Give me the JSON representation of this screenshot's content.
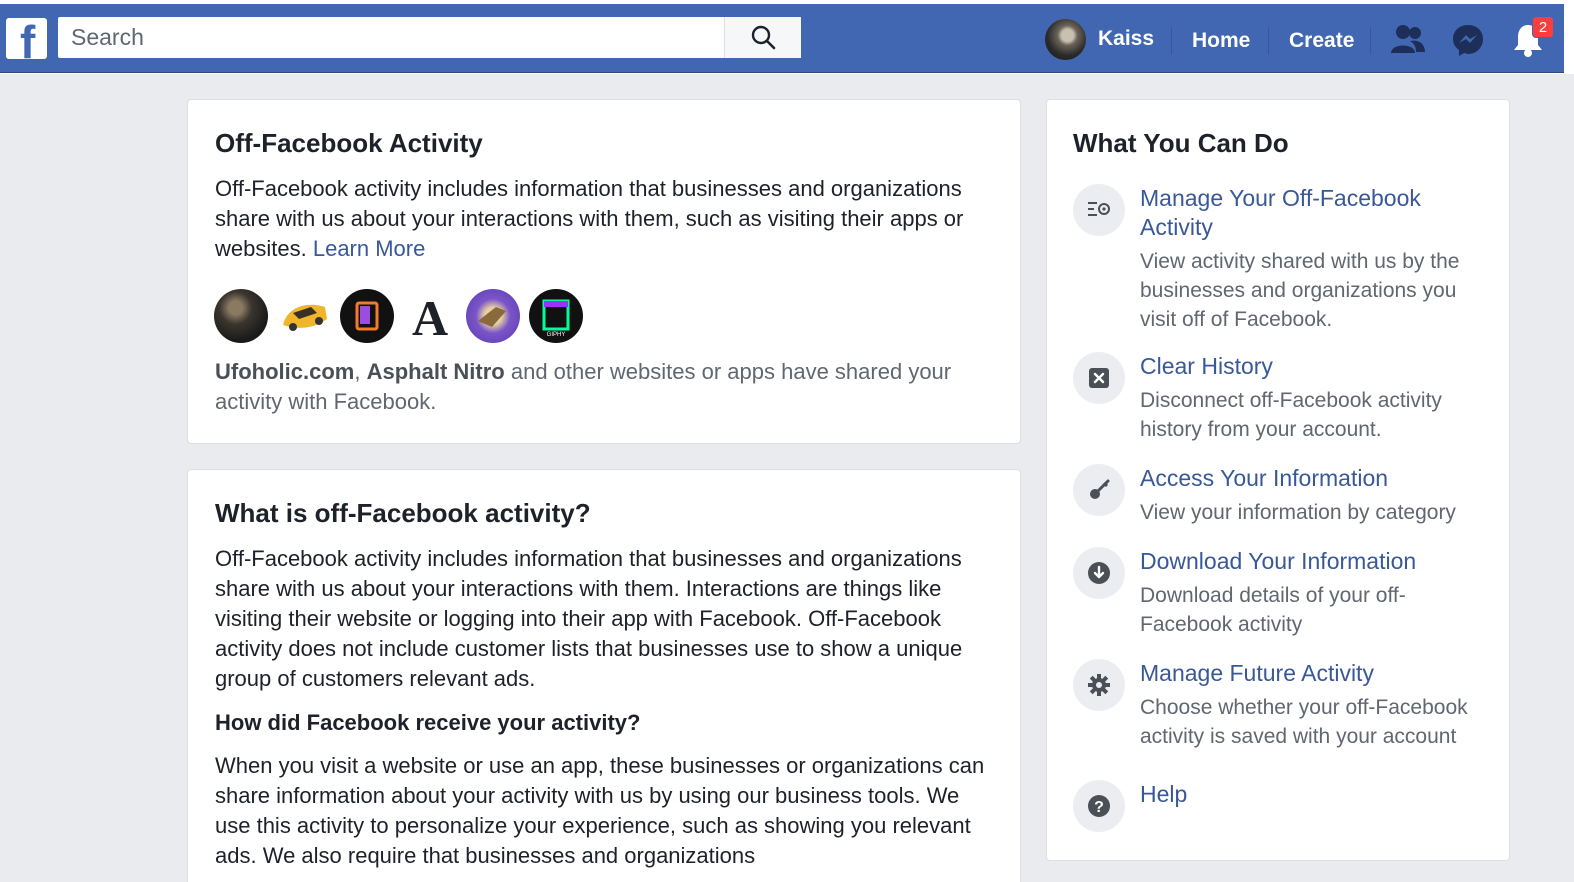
{
  "header": {
    "logo": "f",
    "search_placeholder": "Search",
    "profile_name": "Kaiss",
    "nav_home": "Home",
    "nav_create": "Create",
    "notifications_count": "2"
  },
  "activity_card": {
    "title": "Off-Facebook Activity",
    "description": "Off-Facebook activity includes information that businesses and organizations share with us about your interactions with them, such as visiting their apps or websites.",
    "learn_more": "Learn More",
    "apps": [
      "ufoholic-icon",
      "asphalt-nitro-icon",
      "pages-app-icon",
      "font-a-icon",
      "game-app-icon",
      "giphy-icon"
    ],
    "shared_app_1": "Ufoholic.com",
    "shared_comma": ",",
    "shared_app_2": "Asphalt Nitro",
    "shared_text": "and other websites or apps have shared your activity with Facebook."
  },
  "info_card": {
    "title": "What is off-Facebook activity?",
    "paragraph_1": "Off-Facebook activity includes information that businesses and organizations share with us about your interactions with them. Interactions are things like visiting their website or logging into their app with Facebook. Off-Facebook activity does not include customer lists that businesses use to show a unique group of customers relevant ads.",
    "subheading": "How did Facebook receive your activity?",
    "paragraph_2": "When you visit a website or use an app, these businesses or organizations can share information about your activity with us by using our business tools. We use this activity to personalize your experience, such as showing you relevant ads. We also require that businesses and organizations"
  },
  "sidebar": {
    "title": "What You Can Do",
    "actions": [
      {
        "title": "Manage Your Off-Facebook Activity",
        "description": "View activity shared with us by the businesses and organizations you visit off of Facebook.",
        "icon": "manage-list-icon"
      },
      {
        "title": "Clear History",
        "description": "Disconnect off-Facebook activity history from your account.",
        "icon": "clear-x-icon"
      },
      {
        "title": "Access Your Information",
        "description": "View your information by category",
        "icon": "key-icon"
      },
      {
        "title": "Download Your Information",
        "description": "Download details of your off-Facebook activity",
        "icon": "download-icon"
      },
      {
        "title": "Manage Future Activity",
        "description": "Choose whether your off-Facebook activity is saved with your account",
        "icon": "gear-icon"
      },
      {
        "title": "Help",
        "description": "",
        "icon": "help-icon"
      }
    ]
  },
  "colors": {
    "brand_blue": "#4267b2",
    "link_blue": "#385898",
    "page_bg": "#e9ebee",
    "badge_red": "#fa3e3e"
  }
}
